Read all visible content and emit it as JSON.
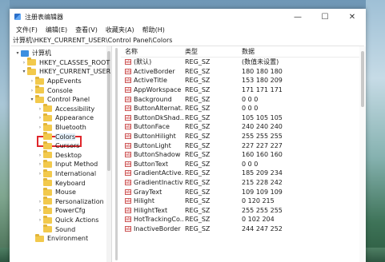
{
  "window": {
    "title": "注册表编辑器",
    "controls": {
      "minimize": "—",
      "maximize": "☐",
      "close": "✕"
    }
  },
  "menu": [
    "文件(F)",
    "编辑(E)",
    "查看(V)",
    "收藏夹(A)",
    "帮助(H)"
  ],
  "address": "计算机\\HKEY_CURRENT_USER\\Control Panel\\Colors",
  "tree": [
    {
      "label": "计算机",
      "level": 0,
      "arrow": "▾",
      "icon": "computer-icon"
    },
    {
      "label": "HKEY_CLASSES_ROOT",
      "level": 1,
      "arrow": "›",
      "icon": "folder-icon"
    },
    {
      "label": "HKEY_CURRENT_USER",
      "level": 1,
      "arrow": "▾",
      "icon": "folder-icon"
    },
    {
      "label": "AppEvents",
      "level": 2,
      "arrow": "›",
      "icon": "folder-icon"
    },
    {
      "label": "Console",
      "level": 2,
      "arrow": "›",
      "icon": "folder-icon"
    },
    {
      "label": "Control Panel",
      "level": 2,
      "arrow": "▾",
      "icon": "folder-icon"
    },
    {
      "label": "Accessibility",
      "level": 3,
      "arrow": "›",
      "icon": "folder-icon"
    },
    {
      "label": "Appearance",
      "level": 3,
      "arrow": "›",
      "icon": "folder-icon"
    },
    {
      "label": "Bluetooth",
      "level": 3,
      "arrow": "›",
      "icon": "folder-icon"
    },
    {
      "label": "Colors",
      "level": 3,
      "arrow": "",
      "icon": "folder-icon",
      "selected": true
    },
    {
      "label": "Cursors",
      "level": 3,
      "arrow": "",
      "icon": "folder-icon"
    },
    {
      "label": "Desktop",
      "level": 3,
      "arrow": "›",
      "icon": "folder-icon"
    },
    {
      "label": "Input Method",
      "level": 3,
      "arrow": "›",
      "icon": "folder-icon"
    },
    {
      "label": "International",
      "level": 3,
      "arrow": "›",
      "icon": "folder-icon"
    },
    {
      "label": "Keyboard",
      "level": 3,
      "arrow": "",
      "icon": "folder-icon"
    },
    {
      "label": "Mouse",
      "level": 3,
      "arrow": "",
      "icon": "folder-icon"
    },
    {
      "label": "Personalization",
      "level": 3,
      "arrow": "›",
      "icon": "folder-icon"
    },
    {
      "label": "PowerCfg",
      "level": 3,
      "arrow": "›",
      "icon": "folder-icon"
    },
    {
      "label": "Quick Actions",
      "level": 3,
      "arrow": "›",
      "icon": "folder-icon"
    },
    {
      "label": "Sound",
      "level": 3,
      "arrow": "",
      "icon": "folder-icon"
    },
    {
      "label": "Environment",
      "level": 2,
      "arrow": "",
      "icon": "folder-icon"
    }
  ],
  "columns": {
    "name": "名称",
    "type": "类型",
    "data": "数据"
  },
  "values": [
    {
      "name": "(默认)",
      "type": "REG_SZ",
      "data": "(数值未设置)"
    },
    {
      "name": "ActiveBorder",
      "type": "REG_SZ",
      "data": "180 180 180"
    },
    {
      "name": "ActiveTitle",
      "type": "REG_SZ",
      "data": "153 180 209"
    },
    {
      "name": "AppWorkspace",
      "type": "REG_SZ",
      "data": "171 171 171"
    },
    {
      "name": "Background",
      "type": "REG_SZ",
      "data": "0 0 0"
    },
    {
      "name": "ButtonAlternat...",
      "type": "REG_SZ",
      "data": "0 0 0"
    },
    {
      "name": "ButtonDkShad...",
      "type": "REG_SZ",
      "data": "105 105 105"
    },
    {
      "name": "ButtonFace",
      "type": "REG_SZ",
      "data": "240 240 240"
    },
    {
      "name": "ButtonHilight",
      "type": "REG_SZ",
      "data": "255 255 255"
    },
    {
      "name": "ButtonLight",
      "type": "REG_SZ",
      "data": "227 227 227"
    },
    {
      "name": "ButtonShadow",
      "type": "REG_SZ",
      "data": "160 160 160"
    },
    {
      "name": "ButtonText",
      "type": "REG_SZ",
      "data": "0 0 0"
    },
    {
      "name": "GradientActive...",
      "type": "REG_SZ",
      "data": "185 209 234"
    },
    {
      "name": "GradientInactiv...",
      "type": "REG_SZ",
      "data": "215 228 242"
    },
    {
      "name": "GrayText",
      "type": "REG_SZ",
      "data": "109 109 109"
    },
    {
      "name": "Hilight",
      "type": "REG_SZ",
      "data": "0 120 215"
    },
    {
      "name": "HilightText",
      "type": "REG_SZ",
      "data": "255 255 255"
    },
    {
      "name": "HotTrackingCo...",
      "type": "REG_SZ",
      "data": "0 102 204"
    },
    {
      "name": "InactiveBorder",
      "type": "REG_SZ",
      "data": "244 247 252"
    }
  ],
  "value_icon": "ab",
  "accent": "#e0262b"
}
